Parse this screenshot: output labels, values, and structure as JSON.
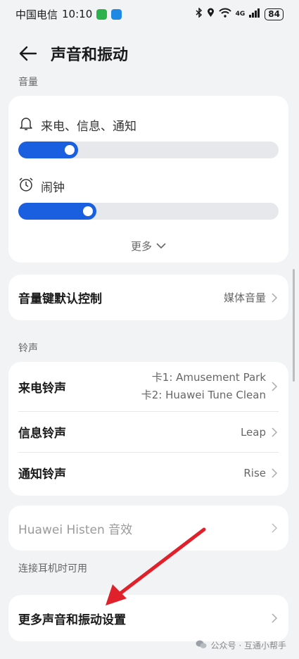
{
  "status_bar": {
    "carrier": "中国电信",
    "time": "10:10",
    "app1_color": "#2bb24c",
    "app2_color": "#1e88e5",
    "network": "4G",
    "battery": "84"
  },
  "header": {
    "title": "声音和振动"
  },
  "volume": {
    "section_label": "音量",
    "ringer_label": "来电、信息、通知",
    "ringer_level": 0.18,
    "alarm_label": "闹钟",
    "alarm_level": 0.25,
    "more_label": "更多"
  },
  "volume_key": {
    "title": "音量键默认控制",
    "value": "媒体音量"
  },
  "ringtone": {
    "section_label": "铃声",
    "call_title": "来电铃声",
    "call_value_sim1": "卡1: Amusement Park",
    "call_value_sim2": "卡2: Huawei Tune Clean",
    "message_title": "信息铃声",
    "message_value": "Leap",
    "notify_title": "通知铃声",
    "notify_value": "Rise"
  },
  "histen": {
    "title": "Huawei Histen 音效",
    "section_note": "连接耳机时可用"
  },
  "more_settings": {
    "title": "更多声音和振动设置"
  },
  "watermark": {
    "text": "公众号 · 互通小帮手"
  },
  "colors": {
    "accent": "#1a5fe0",
    "annotation_arrow": "#e0202a"
  }
}
